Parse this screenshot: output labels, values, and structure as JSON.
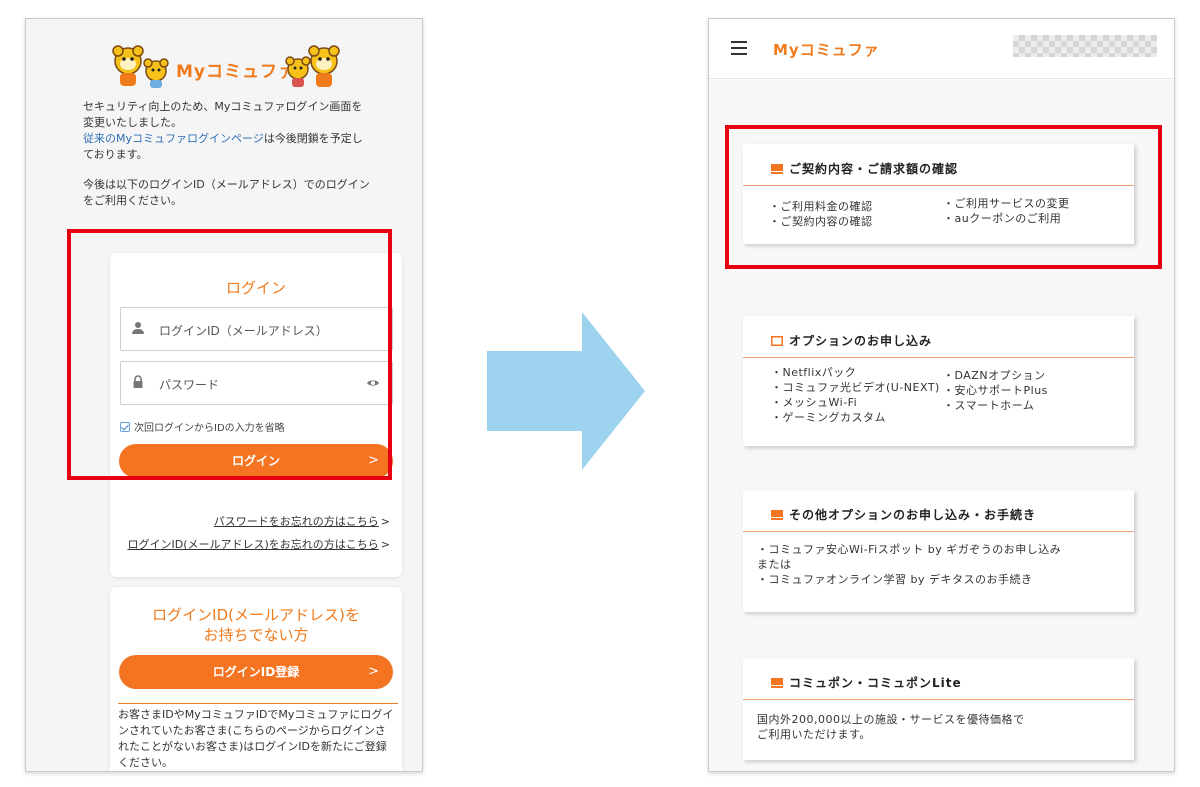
{
  "left": {
    "brand": "Myコミュファ",
    "notice": {
      "line1": "セキュリティ向上のため、Myコミュファログイン画面を",
      "line2": "変更いたしました。",
      "link": "従来のMyコミュファログインページ",
      "line3_suffix": "は今後閉鎖を予定し",
      "line4": "ております。",
      "line5": "今後は以下のログインID（メールアドレス）でのログイン",
      "line6": "をご利用ください。"
    },
    "login": {
      "title": "ログイン",
      "id_placeholder": "ログインID（メールアドレス）",
      "password_placeholder": "パスワード",
      "remember_label": "次回ログインからIDの入力を省略",
      "button_label": "ログイン",
      "button_arrow": ">",
      "forgot_password": "パスワードをお忘れの方はこちら",
      "forgot_id": "ログインID(メールアドレス)をお忘れの方はこちら",
      "link_arrow": ">"
    },
    "no_id": {
      "title_line1": "ログインID(メールアドレス)を",
      "title_line2": "お持ちでない方",
      "button_label": "ログインID登録",
      "button_arrow": ">",
      "text_line1": "お客さまIDやMyコミュファIDでMyコミュファにログイ",
      "text_line2": "ンされていたお客さま(こちらのページからログインさ",
      "text_line3": "れたことがないお客さま)はログインIDを新たにご登録",
      "text_line4": "ください。"
    }
  },
  "right": {
    "brand": "Myコミュファ",
    "cards": [
      {
        "title": "ご契約内容・ご請求額の確認",
        "col1": [
          "・ご利用料金の確認",
          "・ご契約内容の確認"
        ],
        "col2": [
          "・ご利用サービスの変更",
          "・auクーポンのご利用"
        ]
      },
      {
        "title": "オプションのお申し込み",
        "col1": [
          "・Netflixパック",
          "・コミュファ光ビデオ(U-NEXT)",
          "・メッシュWi-Fi",
          "・ゲーミングカスタム"
        ],
        "col2": [
          "・DAZNオプション",
          "・安心サポートPlus",
          "・スマートホーム"
        ]
      },
      {
        "title": "その他オプションのお申し込み・お手続き",
        "col1": [
          "・コミュファ安心Wi-Fiスポット by ギガぞうのお申し込み",
          "または",
          "・コミュファオンライン学習 by デキタスのお手続き"
        ]
      },
      {
        "title": "コミュポン・コミュポンLite",
        "col1": [
          "国内外200,000以上の施設・サービスを優待価格で",
          "ご利用いただけます。"
        ]
      }
    ]
  },
  "colors": {
    "accent_orange": "#f47421",
    "highlight_red": "#e60012",
    "arrow_blue": "#9ed3f0",
    "link_blue": "#2f6fb8"
  }
}
